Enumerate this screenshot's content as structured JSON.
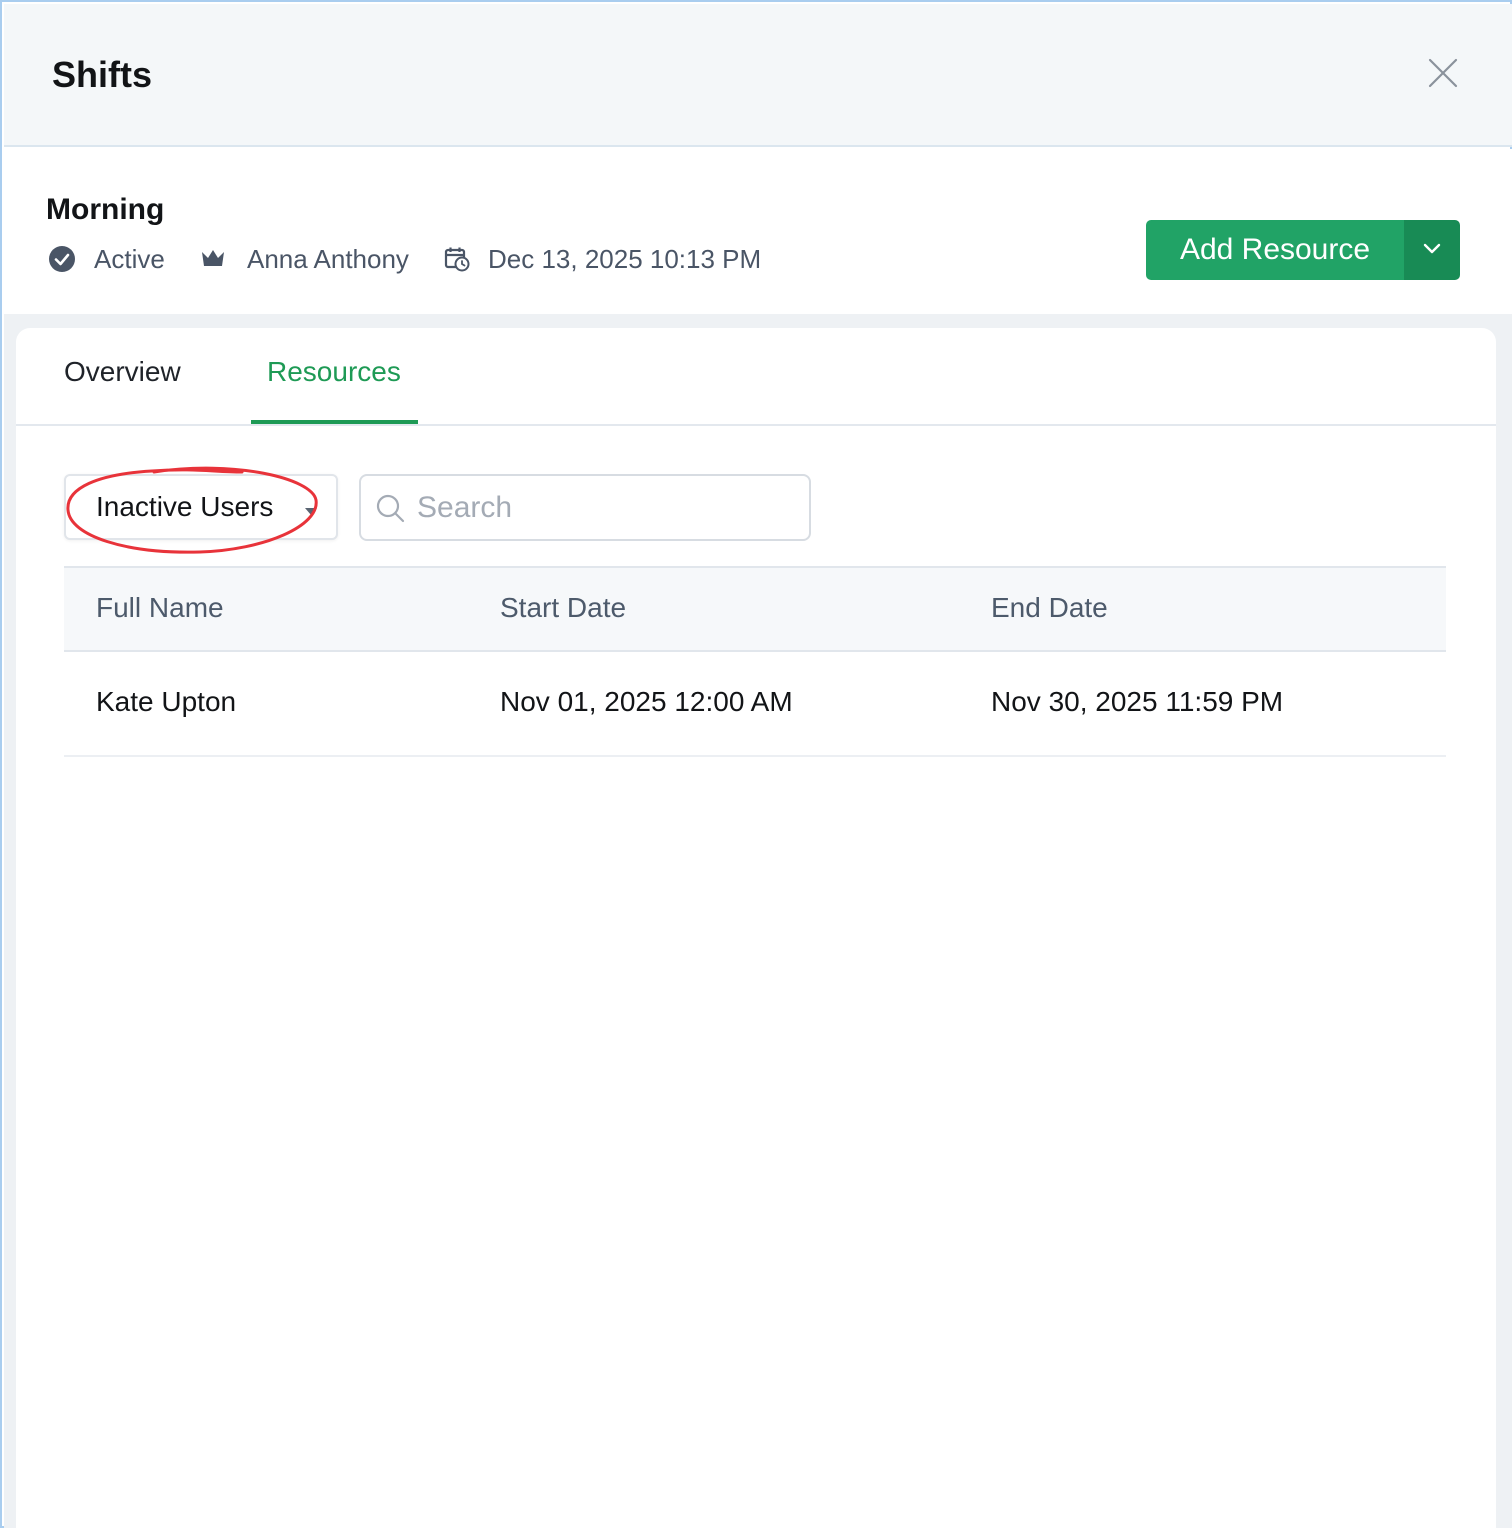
{
  "header": {
    "title": "Shifts"
  },
  "shift": {
    "name": "Morning",
    "status": "Active",
    "owner": "Anna Anthony",
    "datetime": "Dec 13, 2025 10:13 PM"
  },
  "actions": {
    "add_resource_label": "Add Resource"
  },
  "tabs": [
    {
      "label": "Overview",
      "active": false
    },
    {
      "label": "Resources",
      "active": true
    }
  ],
  "filter": {
    "selected": "Inactive Users"
  },
  "search": {
    "placeholder": "Search",
    "value": ""
  },
  "table": {
    "columns": [
      "Full Name",
      "Start Date",
      "End Date"
    ],
    "rows": [
      [
        "Kate Upton",
        "Nov 01, 2025 12:00 AM",
        "Nov 30, 2025 11:59 PM"
      ]
    ]
  },
  "colors": {
    "accent_green": "#21a366",
    "active_tab": "#1e9a55",
    "annotation_red": "#e8333a"
  }
}
